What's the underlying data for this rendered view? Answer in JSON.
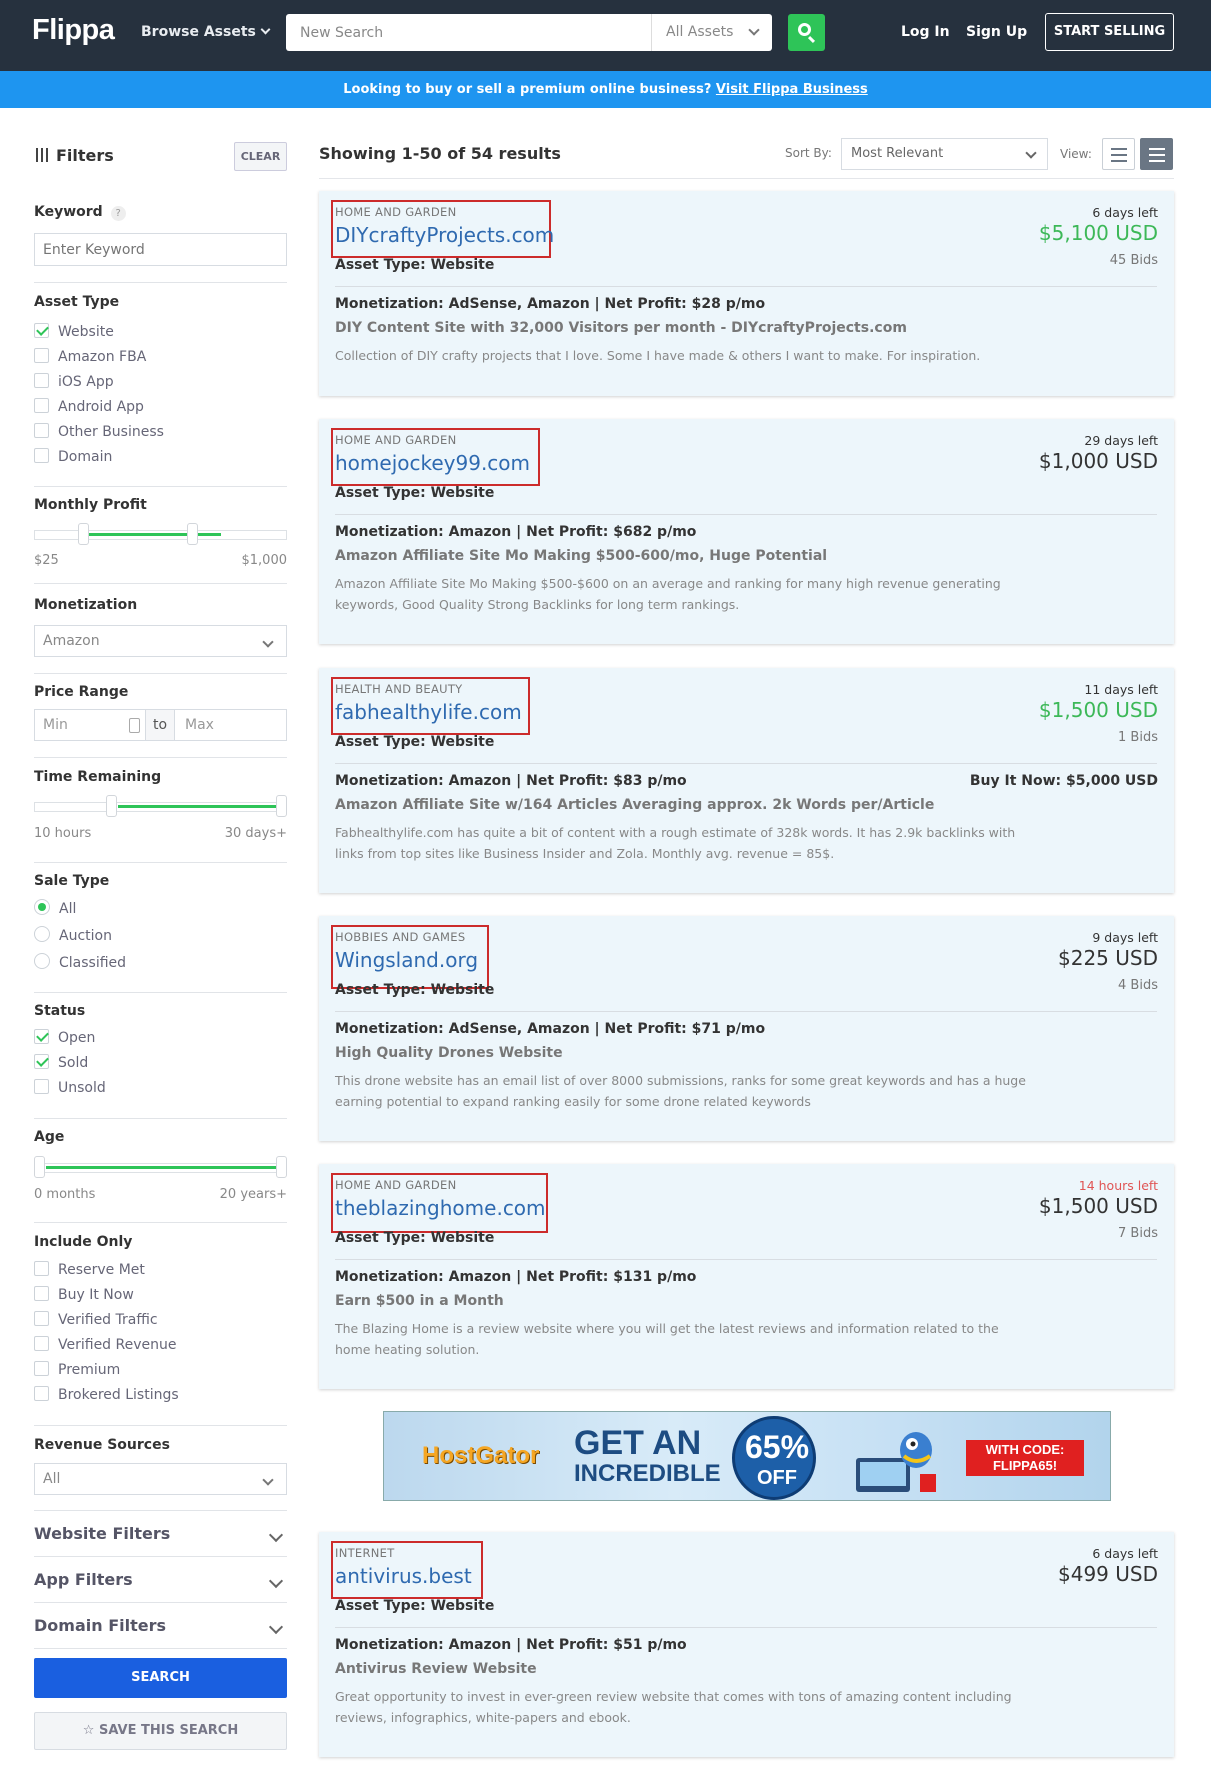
{
  "header": {
    "logo": "Flippa",
    "browse_label": "Browse Assets",
    "search_placeholder": "New Search",
    "asset_select": "All Assets",
    "login": "Log In",
    "signup": "Sign Up",
    "start_selling": "START SELLING"
  },
  "banner": {
    "text": "Looking to buy or sell a premium online business?",
    "link": "Visit Flippa Business"
  },
  "filters": {
    "title": "Filters",
    "clear": "CLEAR",
    "keyword_label": "Keyword",
    "keyword_help": "?",
    "keyword_placeholder": "Enter Keyword",
    "asset_type_label": "Asset Type",
    "asset_types": [
      {
        "label": "Website",
        "checked": true
      },
      {
        "label": "Amazon FBA",
        "checked": false
      },
      {
        "label": "iOS App",
        "checked": false
      },
      {
        "label": "Android App",
        "checked": false
      },
      {
        "label": "Other Business",
        "checked": false
      },
      {
        "label": "Domain",
        "checked": false
      }
    ],
    "monthly_profit_label": "Monthly Profit",
    "monthly_profit_min": "$25",
    "monthly_profit_max": "$1,000",
    "monetization_label": "Monetization",
    "monetization_value": "Amazon",
    "price_range_label": "Price Range",
    "price_min_placeholder": "Min",
    "price_to": "to",
    "price_max_placeholder": "Max",
    "time_remaining_label": "Time Remaining",
    "time_min": "10 hours",
    "time_max": "30 days+",
    "sale_type_label": "Sale Type",
    "sale_types": [
      {
        "label": "All",
        "checked": true
      },
      {
        "label": "Auction",
        "checked": false
      },
      {
        "label": "Classified",
        "checked": false
      }
    ],
    "status_label": "Status",
    "statuses": [
      {
        "label": "Open",
        "checked": true
      },
      {
        "label": "Sold",
        "checked": true
      },
      {
        "label": "Unsold",
        "checked": false
      }
    ],
    "age_label": "Age",
    "age_min": "0 months",
    "age_max": "20 years+",
    "include_only_label": "Include Only",
    "include_only": [
      {
        "label": "Reserve Met",
        "checked": false
      },
      {
        "label": "Buy It Now",
        "checked": false
      },
      {
        "label": "Verified Traffic",
        "checked": false
      },
      {
        "label": "Verified Revenue",
        "checked": false
      },
      {
        "label": "Premium",
        "checked": false
      },
      {
        "label": "Brokered Listings",
        "checked": false
      }
    ],
    "revenue_sources_label": "Revenue Sources",
    "revenue_sources_value": "All",
    "website_filters": "Website Filters",
    "app_filters": "App Filters",
    "domain_filters": "Domain Filters",
    "search_button": "SEARCH",
    "save_search": "SAVE THIS SEARCH"
  },
  "results": {
    "summary": "Showing 1-50 of 54 results",
    "sort_label": "Sort By:",
    "sort_value": "Most Relevant",
    "view_label": "View:"
  },
  "listings": [
    {
      "category": "HOME AND GARDEN",
      "name": "DIYcraftyProjects.com",
      "asset_type": "Asset Type: Website",
      "monetization": "Monetization: AdSense, Amazon | Net Profit: $28 p/mo",
      "headline": "DIY Content Site with 32,000 Visitors per month - DIYcraftyProjects.com",
      "description": "Collection of DIY crafty projects that I love. Some I have made & others I want to make. For inspiration.",
      "time_left": "6 days left",
      "price": "$5,100 USD",
      "bids": "45 Bids",
      "buy_it_now": ""
    },
    {
      "category": "HOME AND GARDEN",
      "name": "homejockey99.com",
      "asset_type": "Asset Type: Website",
      "monetization": "Monetization: Amazon | Net Profit: $682 p/mo",
      "headline": "Amazon Affiliate Site Mo Making $500-600/mo, Huge Potential",
      "description": "Amazon Affiliate Site Mo Making $500-$600 on an average and ranking for many high revenue generating keywords, Good Quality Strong Backlinks for long term rankings.",
      "time_left": "29 days left",
      "price": "$1,000 USD",
      "bids": "",
      "buy_it_now": ""
    },
    {
      "category": "HEALTH AND BEAUTY",
      "name": "fabhealthylife.com",
      "asset_type": "Asset Type: Website",
      "monetization": "Monetization: Amazon | Net Profit: $83 p/mo",
      "headline": "Amazon Affiliate Site w/164 Articles Averaging approx. 2k Words per/Article",
      "description": "Fabhealthylife.com has quite a bit of content with a rough estimate of 328k words. It has 2.9k backlinks with links from top sites like Business Insider and Zola. Monthly avg. revenue = 85$.",
      "time_left": "11 days left",
      "price": "$1,500 USD",
      "bids": "1 Bids",
      "buy_it_now": "Buy It Now: $5,000 USD"
    },
    {
      "category": "HOBBIES AND GAMES",
      "name": "Wingsland.org",
      "asset_type": "Asset Type: Website",
      "monetization": "Monetization: AdSense, Amazon | Net Profit: $71 p/mo",
      "headline": "High Quality Drones Website",
      "description": "This drone website has an email list of over 8000 submissions, ranks for some great keywords and has a huge earning potential to expand ranking easily for some drone related keywords",
      "time_left": "9 days left",
      "price": "$225 USD",
      "bids": "4 Bids",
      "buy_it_now": ""
    },
    {
      "category": "HOME AND GARDEN",
      "name": "theblazinghome.com",
      "asset_type": "Asset Type: Website",
      "monetization": "Monetization: Amazon | Net Profit: $131 p/mo",
      "headline": "Earn $500 in a Month",
      "description": "The Blazing Home is a review website where you will get the latest reviews and information related to the home heating solution.",
      "time_left": "14 hours left",
      "price": "$1,500 USD",
      "bids": "7 Bids",
      "buy_it_now": ""
    },
    {
      "category": "INTERNET",
      "name": "antivirus.best",
      "asset_type": "Asset Type: Website",
      "monetization": "Monetization: Amazon | Net Profit: $51 p/mo",
      "headline": "Antivirus Review Website",
      "description": "Great opportunity to invest in ever-green review website that comes with tons of amazing content including reviews, infographics, white-papers and ebook.",
      "time_left": "6 days left",
      "price": "$499 USD",
      "bids": "",
      "buy_it_now": ""
    }
  ],
  "ad": {
    "brand": "HostGator",
    "line1": "GET AN",
    "line2": "INCREDIBLE",
    "discount": "65%",
    "off": "OFF",
    "code_line1": "WITH CODE:",
    "code_line2": "FLIPPA65!"
  },
  "colors": {
    "header_bg": "#26313e",
    "banner_bg": "#1e95f0",
    "accent_green": "#2ec458",
    "link_blue": "#2f6ab0",
    "search_blue": "#1a5fe0",
    "card_bg": "#edf6fb",
    "highlight_red": "#cc2b2b"
  }
}
